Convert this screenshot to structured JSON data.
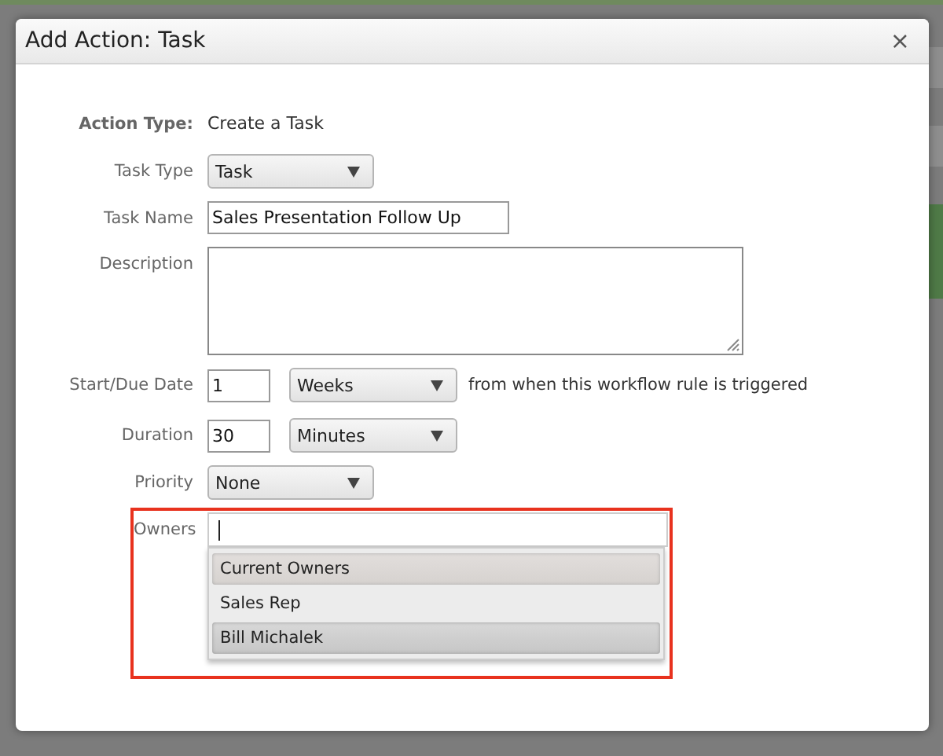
{
  "dialog": {
    "title": "Add Action: Task",
    "close": "×"
  },
  "form": {
    "action_type": {
      "label": "Action Type:",
      "value": "Create a Task"
    },
    "task_type": {
      "label": "Task Type",
      "value": "Task"
    },
    "task_name": {
      "label": "Task Name",
      "value": "Sales Presentation Follow Up"
    },
    "description": {
      "label": "Description"
    },
    "start_due": {
      "label": "Start/Due Date",
      "value": "1",
      "unit": "Weeks",
      "note": "from when this workflow rule is triggered"
    },
    "duration": {
      "label": "Duration",
      "value": "30",
      "unit": "Minutes"
    },
    "priority": {
      "label": "Priority",
      "value": "None"
    },
    "owners": {
      "label": "Owners",
      "focused": true,
      "highlighted": true,
      "options": [
        {
          "label": "Current Owners",
          "kind": "group",
          "selected": false
        },
        {
          "label": "Sales Rep",
          "kind": "option",
          "selected": false
        },
        {
          "label": "Bill Michalek",
          "kind": "option",
          "selected": true
        }
      ]
    }
  }
}
